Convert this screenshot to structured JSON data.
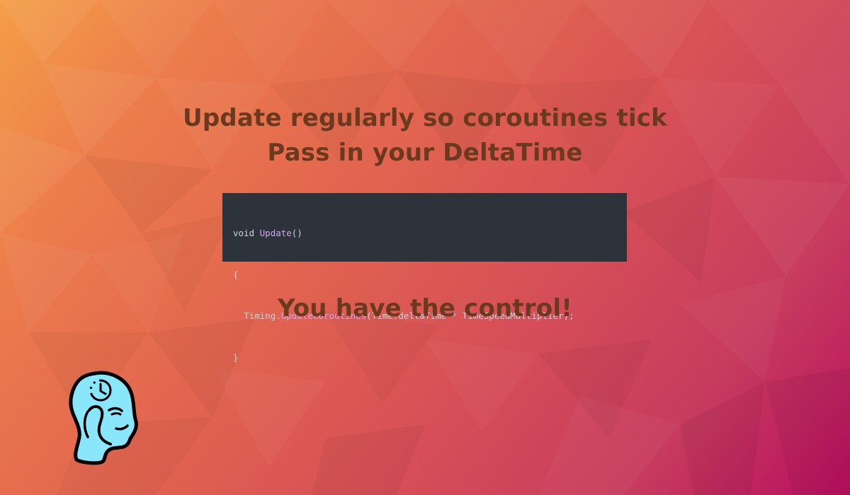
{
  "slide": {
    "line1": "Update regularly so coroutines tick",
    "line2": "Pass in your DeltaTime",
    "line3": "You have the control!"
  },
  "code": {
    "l1_keyword": "void",
    "l1_func": "Update",
    "l1_parens": "()",
    "l2": "{",
    "l3_obj": "Timing.",
    "l3_method": "UpdateCoroutines",
    "l3_args_a": "(Time.deltaTime",
    "l3_op": "*",
    "l3_args_b": "TimeSpeedMultiplier);",
    "l4": "}"
  },
  "logo": {
    "icon": "head-clock-icon"
  },
  "colors": {
    "heading": "#6b3a1e",
    "code_bg": "#2d333b",
    "code_fn": "#d7a4ef",
    "code_op": "#7cb6ff",
    "logo_fill": "#8ae7fb"
  }
}
